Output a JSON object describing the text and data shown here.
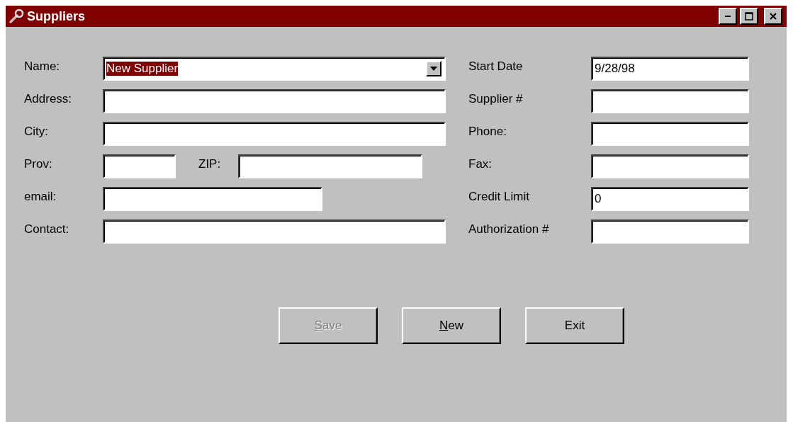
{
  "window": {
    "title": "Suppliers"
  },
  "left_fields": [
    {
      "label": "Name:",
      "kind": "combo",
      "value": "New Supplier",
      "selected": true
    },
    {
      "label": "Address:",
      "kind": "text"
    },
    {
      "label": "City:",
      "kind": "text"
    },
    {
      "label": "Prov:",
      "kind": "pair",
      "second_label": "ZIP:"
    },
    {
      "label": "email:",
      "kind": "short"
    },
    {
      "label": "Contact:",
      "kind": "text"
    }
  ],
  "right_fields": [
    {
      "label": "Start Date",
      "value": "9/28/98"
    },
    {
      "label": "Supplier #"
    },
    {
      "label": "Phone:"
    },
    {
      "label": "Fax:"
    },
    {
      "label": "Credit Limit",
      "value": "0"
    },
    {
      "label": "Authorization #"
    }
  ],
  "buttons": [
    {
      "label": "Save",
      "disabled": true,
      "underline_first": true
    },
    {
      "label": "New",
      "disabled": false,
      "underline_first": true
    },
    {
      "label": "Exit",
      "disabled": false,
      "underline_first": false
    }
  ]
}
